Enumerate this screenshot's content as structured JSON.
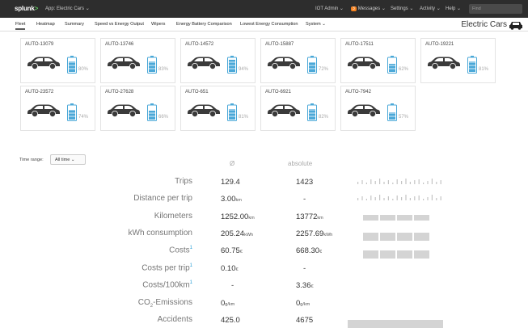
{
  "topbar": {
    "logo": "splunk",
    "logo_suffix": ">",
    "app_label": "App: Electric Cars",
    "user": "IOT Admin",
    "messages_count": "3",
    "messages": "Messages",
    "settings": "Settings",
    "activity": "Activity",
    "help": "Help",
    "find_placeholder": "Find"
  },
  "nav": {
    "items": [
      "Fleet",
      "Heatmap",
      "Summary",
      "Speed vs Energy Output",
      "Wipers",
      "Energy Battery Comparison",
      "Lowest Energy Consumption",
      "System"
    ],
    "active": "Fleet",
    "app_title": "Electric Cars"
  },
  "cars": [
    {
      "id": "AUTO-13079",
      "battery": "80%",
      "level": 0.8
    },
    {
      "id": "AUTO-13746",
      "battery": "83%",
      "level": 0.83
    },
    {
      "id": "AUTO-14572",
      "battery": "94%",
      "level": 0.94
    },
    {
      "id": "AUTO-15887",
      "battery": "72%",
      "level": 0.72
    },
    {
      "id": "AUTO-17511",
      "battery": "62%",
      "level": 0.62
    },
    {
      "id": "AUTO-19221",
      "battery": "81%",
      "level": 0.81
    },
    {
      "id": "AUTO-23572",
      "battery": "74%",
      "level": 0.74
    },
    {
      "id": "AUTO-27628",
      "battery": "66%",
      "level": 0.66
    },
    {
      "id": "AUTO-651",
      "battery": "81%",
      "level": 0.81
    },
    {
      "id": "AUTO-6921",
      "battery": "82%",
      "level": 0.82
    },
    {
      "id": "AUTO-7942",
      "battery": "57%",
      "level": 0.57
    }
  ],
  "stats": {
    "time_range_label": "Time range:",
    "time_range_value": "All time",
    "col_avg": "Ø",
    "col_abs": "absolute",
    "rows": [
      {
        "label": "Trips",
        "avg": "129.4",
        "avg_unit": "",
        "abs": "1423",
        "abs_unit": ""
      },
      {
        "label": "Distance per trip",
        "avg": "3.00",
        "avg_unit": "km",
        "abs": "-",
        "abs_unit": ""
      },
      {
        "label": "Kilometers",
        "avg": "1252.00",
        "avg_unit": "km",
        "abs": "13772",
        "abs_unit": "km"
      },
      {
        "label": "kWh consumption",
        "avg": "205.24",
        "avg_unit": "kWh",
        "abs": "2257.69",
        "abs_unit": "kWh"
      },
      {
        "label": "Costs",
        "sup": "1",
        "avg": "60.75",
        "avg_unit": "€",
        "abs": "668.30",
        "abs_unit": "€"
      },
      {
        "label": "Costs per trip",
        "sup": "1",
        "avg": "0.10",
        "avg_unit": "€",
        "abs": "-",
        "abs_unit": ""
      },
      {
        "label": "Costs/100km",
        "sup": "1",
        "avg": "-",
        "avg_unit": "",
        "abs": "3.36",
        "abs_unit": "€"
      },
      {
        "label": "CO",
        "label_sub": "2",
        "label_tail": "-Emissions",
        "avg": "0",
        "avg_unit": "g/km",
        "abs": "0",
        "abs_unit": "g/km"
      },
      {
        "label": "Accidents",
        "avg": "425.0",
        "avg_unit": "",
        "abs": "4675",
        "abs_unit": ""
      }
    ]
  },
  "colors": {
    "topbar": "#2d2d2d",
    "battery": "#4aa8d8",
    "car": "#3a3a3a",
    "link": "#2a9fd6"
  }
}
